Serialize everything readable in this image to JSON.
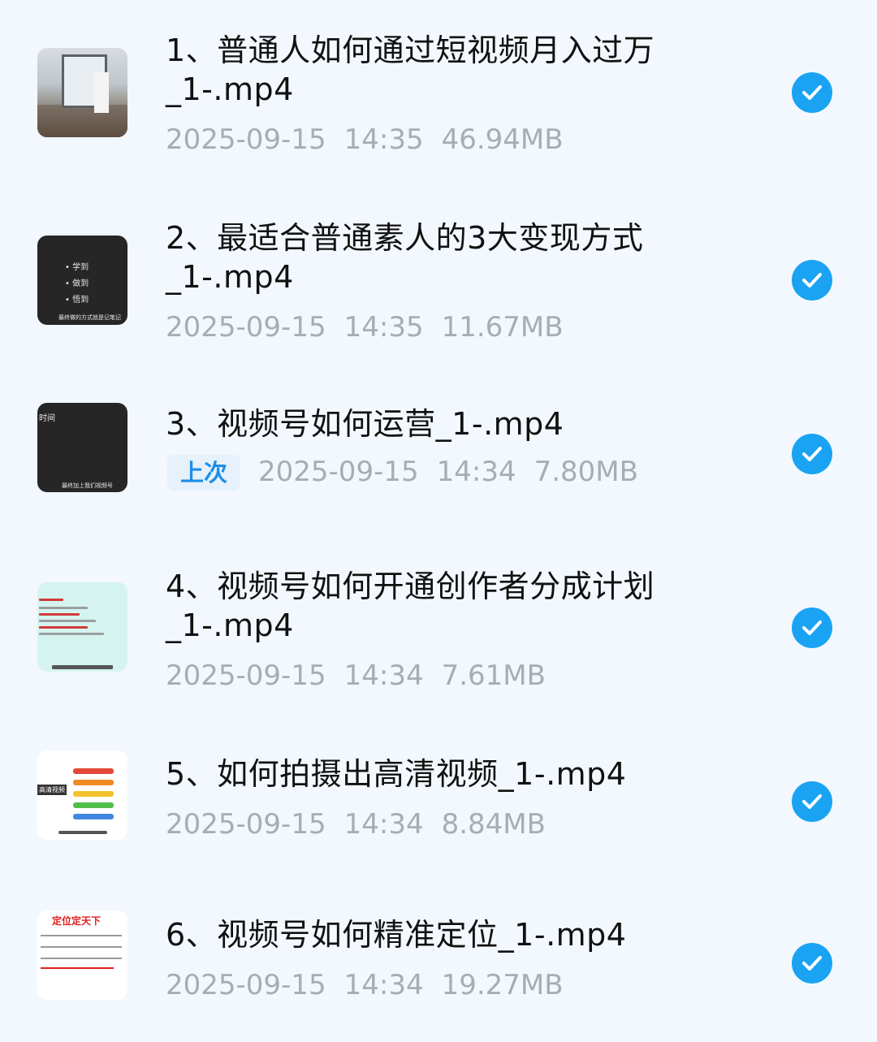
{
  "files": [
    {
      "title": "1、普通人如何通过短视频月入过万\n_1-.mp4",
      "date": "2025-09-15",
      "time": "14:35",
      "size": "46.94MB",
      "tag": ""
    },
    {
      "title": "2、最适合普通素人的3大变现方式\n_1-.mp4",
      "date": "2025-09-15",
      "time": "14:35",
      "size": "11.67MB",
      "tag": "",
      "thumb_lines": [
        "• 学到",
        "• 做到",
        "• 悟到",
        "最终做的方式就是记笔记"
      ]
    },
    {
      "title": "3、视频号如何运营_1-.mp4",
      "date": "2025-09-15",
      "time": "14:34",
      "size": "7.80MB",
      "tag": "上次",
      "thumb_lines": [
        "时间",
        "最终加上我们视频号"
      ]
    },
    {
      "title": "4、视频号如何开通创作者分成计划\n_1-.mp4",
      "date": "2025-09-15",
      "time": "14:34",
      "size": "7.61MB",
      "tag": ""
    },
    {
      "title": "5、如何拍摄出高清视频_1-.mp4",
      "date": "2025-09-15",
      "time": "14:34",
      "size": "8.84MB",
      "tag": "",
      "thumb_lines": [
        "高清视频"
      ]
    },
    {
      "title": "6、视频号如何精准定位_1-.mp4",
      "date": "2025-09-15",
      "time": "14:34",
      "size": "19.27MB",
      "tag": "",
      "thumb_lines": [
        "定位定天下"
      ]
    }
  ],
  "icons": {
    "check": "checkmark-circle-icon"
  },
  "colors": {
    "accent": "#1aa3f3",
    "background": "#f2f8fd",
    "meta_text": "#a7adb5"
  }
}
